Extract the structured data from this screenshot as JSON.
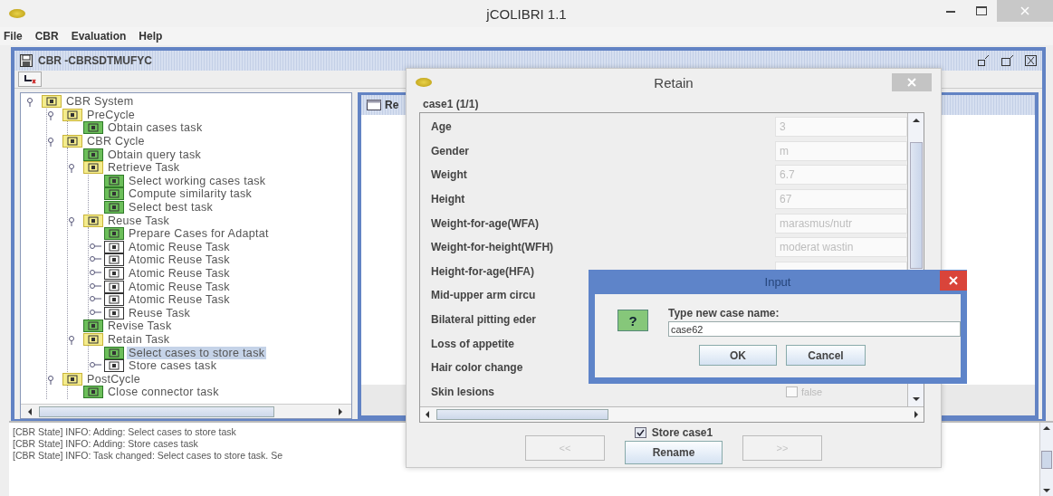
{
  "window": {
    "title": "jCOLIBRI 1.1"
  },
  "menu": [
    "File",
    "CBR",
    "Evaluation",
    "Help"
  ],
  "frame": {
    "title": "CBR -CBRSDTMUFYC"
  },
  "tree": [
    {
      "label": "CBR System",
      "kind": "composite",
      "expanded": true,
      "selected": false,
      "children": [
        {
          "label": "PreCycle",
          "kind": "composite",
          "expanded": true,
          "selected": false,
          "children": [
            {
              "label": "Obtain cases task",
              "kind": "primitive",
              "selected": false
            }
          ]
        },
        {
          "label": "CBR Cycle",
          "kind": "composite",
          "expanded": true,
          "selected": false,
          "children": [
            {
              "label": "Obtain query task",
              "kind": "primitive",
              "selected": false
            },
            {
              "label": "Retrieve Task",
              "kind": "composite",
              "expanded": true,
              "selected": false,
              "children": [
                {
                  "label": "Select working cases task",
                  "kind": "primitive",
                  "selected": false
                },
                {
                  "label": "Compute similarity task",
                  "kind": "primitive",
                  "selected": false
                },
                {
                  "label": "Select best task",
                  "kind": "primitive",
                  "selected": false
                }
              ]
            },
            {
              "label": "Reuse Task",
              "kind": "composite",
              "expanded": true,
              "selected": false,
              "children": [
                {
                  "label": "Prepare Cases for Adaptat",
                  "kind": "primitive",
                  "selected": false
                },
                {
                  "label": "Atomic Reuse Task",
                  "kind": "unresolved",
                  "expanded": false,
                  "selected": false
                },
                {
                  "label": "Atomic Reuse Task",
                  "kind": "unresolved",
                  "expanded": false,
                  "selected": false
                },
                {
                  "label": "Atomic Reuse Task",
                  "kind": "unresolved",
                  "expanded": false,
                  "selected": false
                },
                {
                  "label": "Atomic Reuse Task",
                  "kind": "unresolved",
                  "expanded": false,
                  "selected": false
                },
                {
                  "label": "Atomic Reuse Task",
                  "kind": "unresolved",
                  "expanded": false,
                  "selected": false
                },
                {
                  "label": "Reuse Task",
                  "kind": "unresolved",
                  "expanded": false,
                  "selected": false
                }
              ]
            },
            {
              "label": "Revise Task",
              "kind": "primitive",
              "selected": false
            },
            {
              "label": "Retain Task",
              "kind": "composite",
              "expanded": true,
              "selected": false,
              "children": [
                {
                  "label": "Select cases to store task",
                  "kind": "primitive",
                  "selected": true
                },
                {
                  "label": "Store cases task",
                  "kind": "unresolved",
                  "expanded": false,
                  "selected": false
                }
              ]
            }
          ]
        },
        {
          "label": "PostCycle",
          "kind": "composite",
          "expanded": true,
          "selected": false,
          "children": [
            {
              "label": "Close connector task",
              "kind": "primitive",
              "selected": false
            }
          ]
        }
      ]
    }
  ],
  "right_panel": {
    "tab": "Re"
  },
  "log": [
    "[CBR State] INFO: Adding: Select cases to store task",
    "[CBR State] INFO: Adding: Store cases task",
    "[CBR State] INFO: Task changed: Select cases to store task. Se"
  ],
  "retain": {
    "title": "Retain",
    "group": "case1 (1/1)",
    "rows": [
      {
        "label": "Age",
        "kind": "text",
        "value": "3"
      },
      {
        "label": "Gender",
        "kind": "text",
        "value": "m"
      },
      {
        "label": "Weight",
        "kind": "text",
        "value": "6.7"
      },
      {
        "label": "Height",
        "kind": "text",
        "value": "67"
      },
      {
        "label": "Weight-for-age(WFA)",
        "kind": "text",
        "value": "marasmus/nutr"
      },
      {
        "label": "Weight-for-height(WFH)",
        "kind": "text",
        "value": "moderat wastin"
      },
      {
        "label": "Height-for-age(HFA)",
        "kind": "field"
      },
      {
        "label": "Mid-upper arm circu",
        "kind": "covered"
      },
      {
        "label": "Bilateral pitting eder",
        "kind": "covered"
      },
      {
        "label": "Loss of appetite",
        "kind": "covered"
      },
      {
        "label": "Hair color change",
        "kind": "covered"
      },
      {
        "label": "Skin lesions",
        "kind": "checkbox",
        "checked": false,
        "value": "false"
      }
    ],
    "prev": {
      "label": "<<",
      "disabled": true
    },
    "store": {
      "label": "Store case1",
      "checked": true
    },
    "rename": "Rename",
    "next": {
      "label": ">>",
      "disabled": true
    }
  },
  "input": {
    "title": "Input",
    "icon": "?",
    "prompt": "Type new case name:",
    "value": "case62",
    "ok": "OK",
    "cancel": "Cancel"
  }
}
